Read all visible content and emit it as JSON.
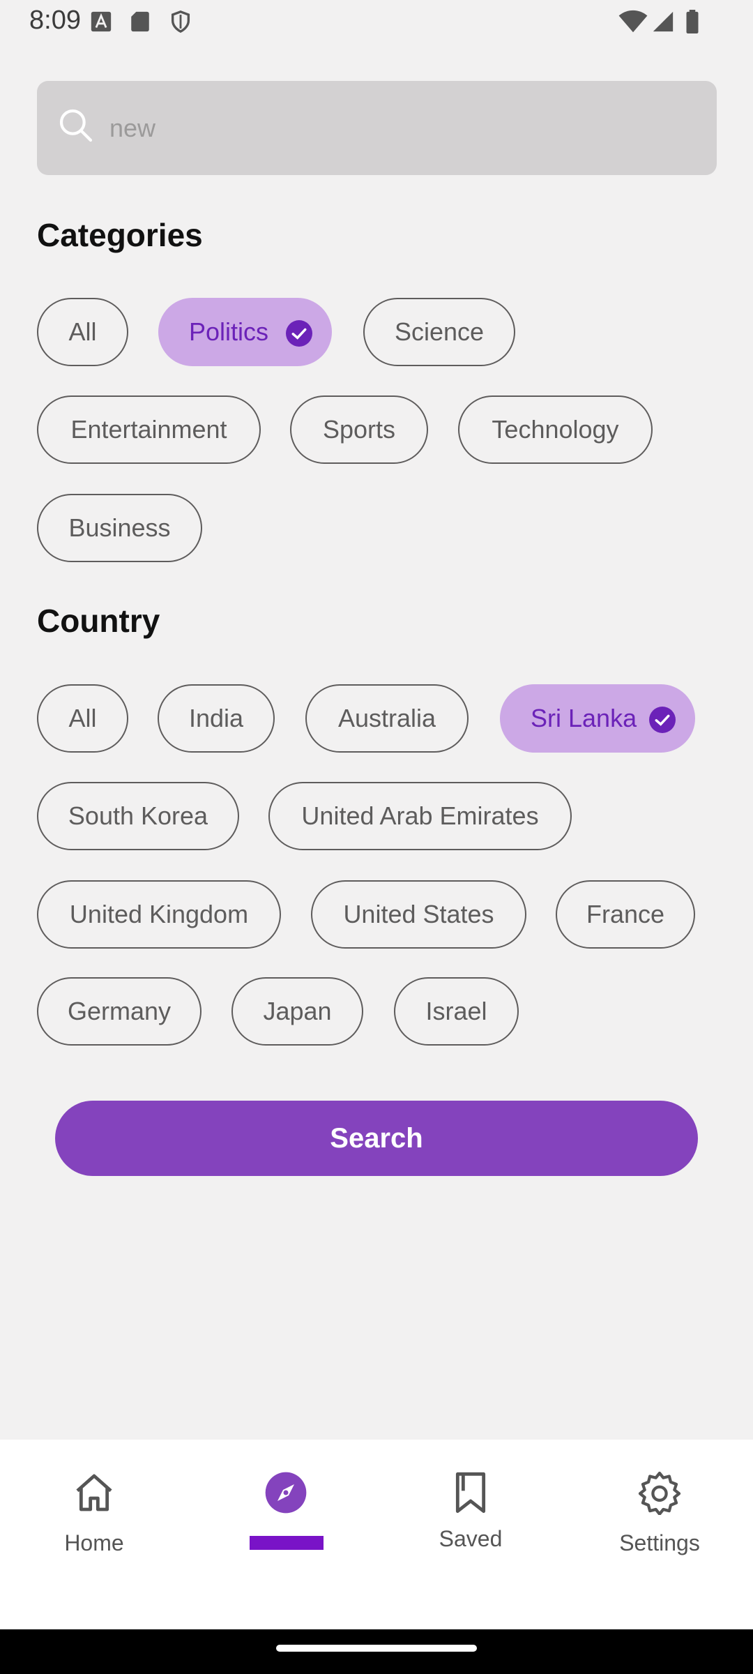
{
  "status_bar": {
    "time": "8:09",
    "icons": [
      "font-icon",
      "sd-card-icon",
      "shield-icon",
      "wifi-icon",
      "signal-icon",
      "battery-icon"
    ]
  },
  "search": {
    "value": "new",
    "placeholder": ""
  },
  "categories": {
    "title": "Categories",
    "items": [
      {
        "label": "All",
        "selected": false
      },
      {
        "label": "Politics",
        "selected": true
      },
      {
        "label": "Science",
        "selected": false
      },
      {
        "label": "Entertainment",
        "selected": false
      },
      {
        "label": "Sports",
        "selected": false
      },
      {
        "label": "Technology",
        "selected": false
      },
      {
        "label": "Business",
        "selected": false
      }
    ]
  },
  "country": {
    "title": "Country",
    "items": [
      {
        "label": "All",
        "selected": false
      },
      {
        "label": "India",
        "selected": false
      },
      {
        "label": "Australia",
        "selected": false
      },
      {
        "label": "Sri Lanka",
        "selected": true
      },
      {
        "label": "South Korea",
        "selected": false
      },
      {
        "label": "United Arab Emirates",
        "selected": false
      },
      {
        "label": "United Kingdom",
        "selected": false
      },
      {
        "label": "United States",
        "selected": false
      },
      {
        "label": "France",
        "selected": false
      },
      {
        "label": "Germany",
        "selected": false
      },
      {
        "label": "Japan",
        "selected": false
      },
      {
        "label": "Israel",
        "selected": false
      }
    ]
  },
  "search_button": {
    "label": "Search"
  },
  "bottom_nav": {
    "items": [
      {
        "label": "Home",
        "icon": "home-icon"
      },
      {
        "label": "",
        "icon": "compass-icon",
        "active": true
      },
      {
        "label": "Saved",
        "icon": "bookmark-icon"
      },
      {
        "label": "Settings",
        "icon": "gear-icon"
      }
    ]
  },
  "colors": {
    "accent": "#8443bd",
    "chip_selected_bg": "#cca8e6",
    "chip_selected_text": "#6b22b8",
    "indicator": "#7913c7"
  }
}
